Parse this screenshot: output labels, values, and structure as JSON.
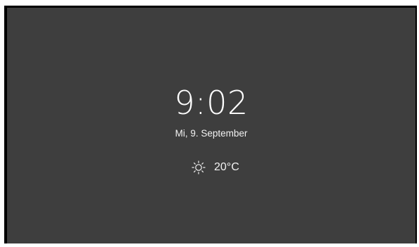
{
  "clock": {
    "time": "9:02",
    "date": "Mi, 9. September"
  },
  "weather": {
    "icon": "sun-icon",
    "temperature": "20°C"
  },
  "colors": {
    "background": "#3e3e3e",
    "frame": "#000000",
    "text": "#ffffff"
  }
}
